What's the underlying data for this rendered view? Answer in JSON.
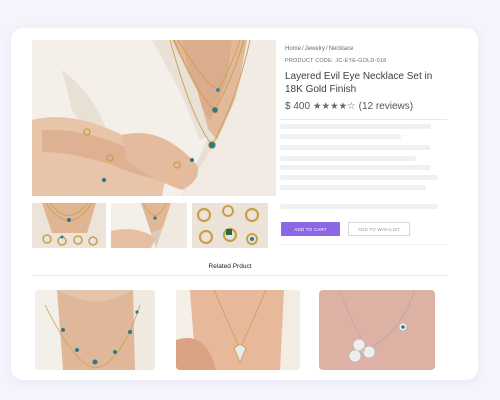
{
  "product": {
    "breadcrumb": [
      "Home",
      "Jewelry",
      "Necklace"
    ],
    "breadcrumb_separator": "/",
    "code": "PRODUCT CODE: JC-EYE-GOLD-018",
    "title": "Layered Evil Eye Necklace Set in 18K Gold Finish",
    "price": "$ 400",
    "rating": 4,
    "rating_max": 5,
    "stars": "★★★★☆",
    "reviews": "(12 reviews)"
  },
  "actions": {
    "add_to_cart": "ADD TO CART",
    "wishlist": "ADD TO WISHLIST"
  },
  "related": {
    "heading": "Related Prduct"
  },
  "colors": {
    "accent": "#8b67e6",
    "background": "#f6f3fc"
  }
}
